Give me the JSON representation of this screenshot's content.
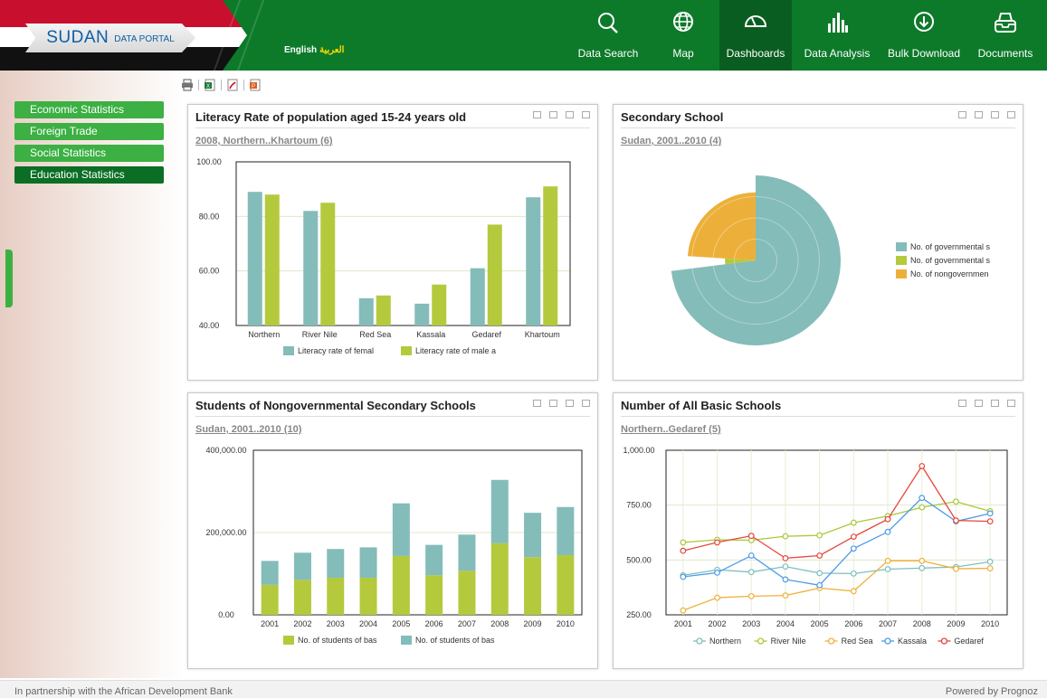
{
  "header": {
    "logo_main": "SUDAN",
    "logo_sub": "DATA PORTAL",
    "lang_en": "English",
    "lang_ar": "العربية",
    "nav": [
      {
        "label": "Data Search",
        "icon": "search-icon"
      },
      {
        "label": "Map",
        "icon": "globe-icon"
      },
      {
        "label": "Dashboards",
        "icon": "gauge-icon",
        "active": true
      },
      {
        "label": "Data Analysis",
        "icon": "bar-chart-icon"
      },
      {
        "label": "Bulk Download",
        "icon": "download-icon"
      },
      {
        "label": "Documents",
        "icon": "inbox-icon"
      }
    ]
  },
  "sidebar": {
    "items": [
      {
        "label": "Economic Statistics"
      },
      {
        "label": "Foreign Trade"
      },
      {
        "label": "Social Statistics"
      },
      {
        "label": "Education Statistics",
        "active": true
      }
    ]
  },
  "toolbar": {
    "icons": [
      "print-icon",
      "excel-icon",
      "pdf-icon",
      "powerpoint-icon"
    ]
  },
  "panels": [
    {
      "title": "Literacy Rate of population aged 15-24 years old",
      "subtitle": "2008, Northern..Khartoum (6)"
    },
    {
      "title": "Secondary School",
      "subtitle": "Sudan, 2001..2010 (4)"
    },
    {
      "title": "Students of Nongovernmental Secondary Schools",
      "subtitle": "Sudan, 2001..2010 (10)"
    },
    {
      "title": "Number of All Basic Schools",
      "subtitle": "Northern..Gedaref (5)"
    }
  ],
  "chart_data": [
    {
      "type": "bar",
      "categories": [
        "Northern",
        "River Nile",
        "Red Sea",
        "Kassala",
        "Gedaref",
        "Khartoum"
      ],
      "series": [
        {
          "name": "Literacy rate of femal",
          "values": [
            89,
            82,
            50,
            48,
            61,
            87
          ],
          "color": "#84bcb9"
        },
        {
          "name": "Literacy rate of male a",
          "values": [
            88,
            85,
            51,
            55,
            77,
            91
          ],
          "color": "#b5c93d"
        }
      ],
      "ylim": [
        40,
        100
      ],
      "yticks": [
        "40.00",
        "60.00",
        "80.00",
        "100.00"
      ],
      "yvals": [
        40,
        60,
        80,
        100
      ],
      "legend": "bottom"
    },
    {
      "type": "pie",
      "series": [
        {
          "name": "No. of governmental s",
          "value": 73,
          "color": "#84bcb9"
        },
        {
          "name": "No. of governmental s",
          "value": 3,
          "color": "#b5c93d"
        },
        {
          "name": "No. of nongovernmen",
          "value": 24,
          "color": "#ecb03a"
        }
      ],
      "legend": "right"
    },
    {
      "type": "bar",
      "stacked": true,
      "categories": [
        "2001",
        "2002",
        "2003",
        "2004",
        "2005",
        "2006",
        "2007",
        "2008",
        "2009",
        "2010"
      ],
      "series": [
        {
          "name": "No. of students of bas",
          "values": [
            73000,
            85000,
            90000,
            90000,
            143000,
            96000,
            107000,
            174000,
            140000,
            145000
          ],
          "color": "#b5c93d"
        },
        {
          "name": "No. of students of bas",
          "values": [
            58000,
            66000,
            70000,
            74000,
            128000,
            74000,
            88000,
            154000,
            108000,
            117000
          ],
          "color": "#84bcb9"
        }
      ],
      "ylim": [
        0,
        400000
      ],
      "yticks": [
        "0.00",
        "200,000.00",
        "400,000.00"
      ],
      "yvals": [
        0,
        200000,
        400000
      ],
      "legend": "bottom"
    },
    {
      "type": "line",
      "categories": [
        "2001",
        "2002",
        "2003",
        "2004",
        "2005",
        "2006",
        "2007",
        "2008",
        "2009",
        "2010"
      ],
      "series": [
        {
          "name": "Northern",
          "values": [
            430,
            455,
            445,
            470,
            440,
            438,
            458,
            463,
            468,
            492
          ],
          "color": "#7ec0bd"
        },
        {
          "name": "River Nile",
          "values": [
            580,
            592,
            590,
            608,
            612,
            670,
            700,
            740,
            766,
            722
          ],
          "color": "#a8c93a"
        },
        {
          "name": "Red Sea",
          "values": [
            270,
            328,
            335,
            338,
            372,
            358,
            496,
            496,
            460,
            462
          ],
          "color": "#f0b03a"
        },
        {
          "name": "Kassala",
          "values": [
            423,
            442,
            520,
            411,
            385,
            552,
            628,
            783,
            676,
            712
          ],
          "color": "#4c9be8"
        },
        {
          "name": "Gedaref",
          "values": [
            542,
            580,
            610,
            508,
            520,
            606,
            686,
            928,
            680,
            676
          ],
          "color": "#e8453c"
        }
      ],
      "ylim": [
        250,
        1000
      ],
      "yticks": [
        "250.00",
        "500.00",
        "750.00",
        "1,000.00"
      ],
      "yvals": [
        250,
        500,
        750,
        1000
      ],
      "legend": "bottom"
    }
  ],
  "footer": {
    "left": "In partnership with the African Development Bank",
    "right": "Powered by Prognoz"
  }
}
